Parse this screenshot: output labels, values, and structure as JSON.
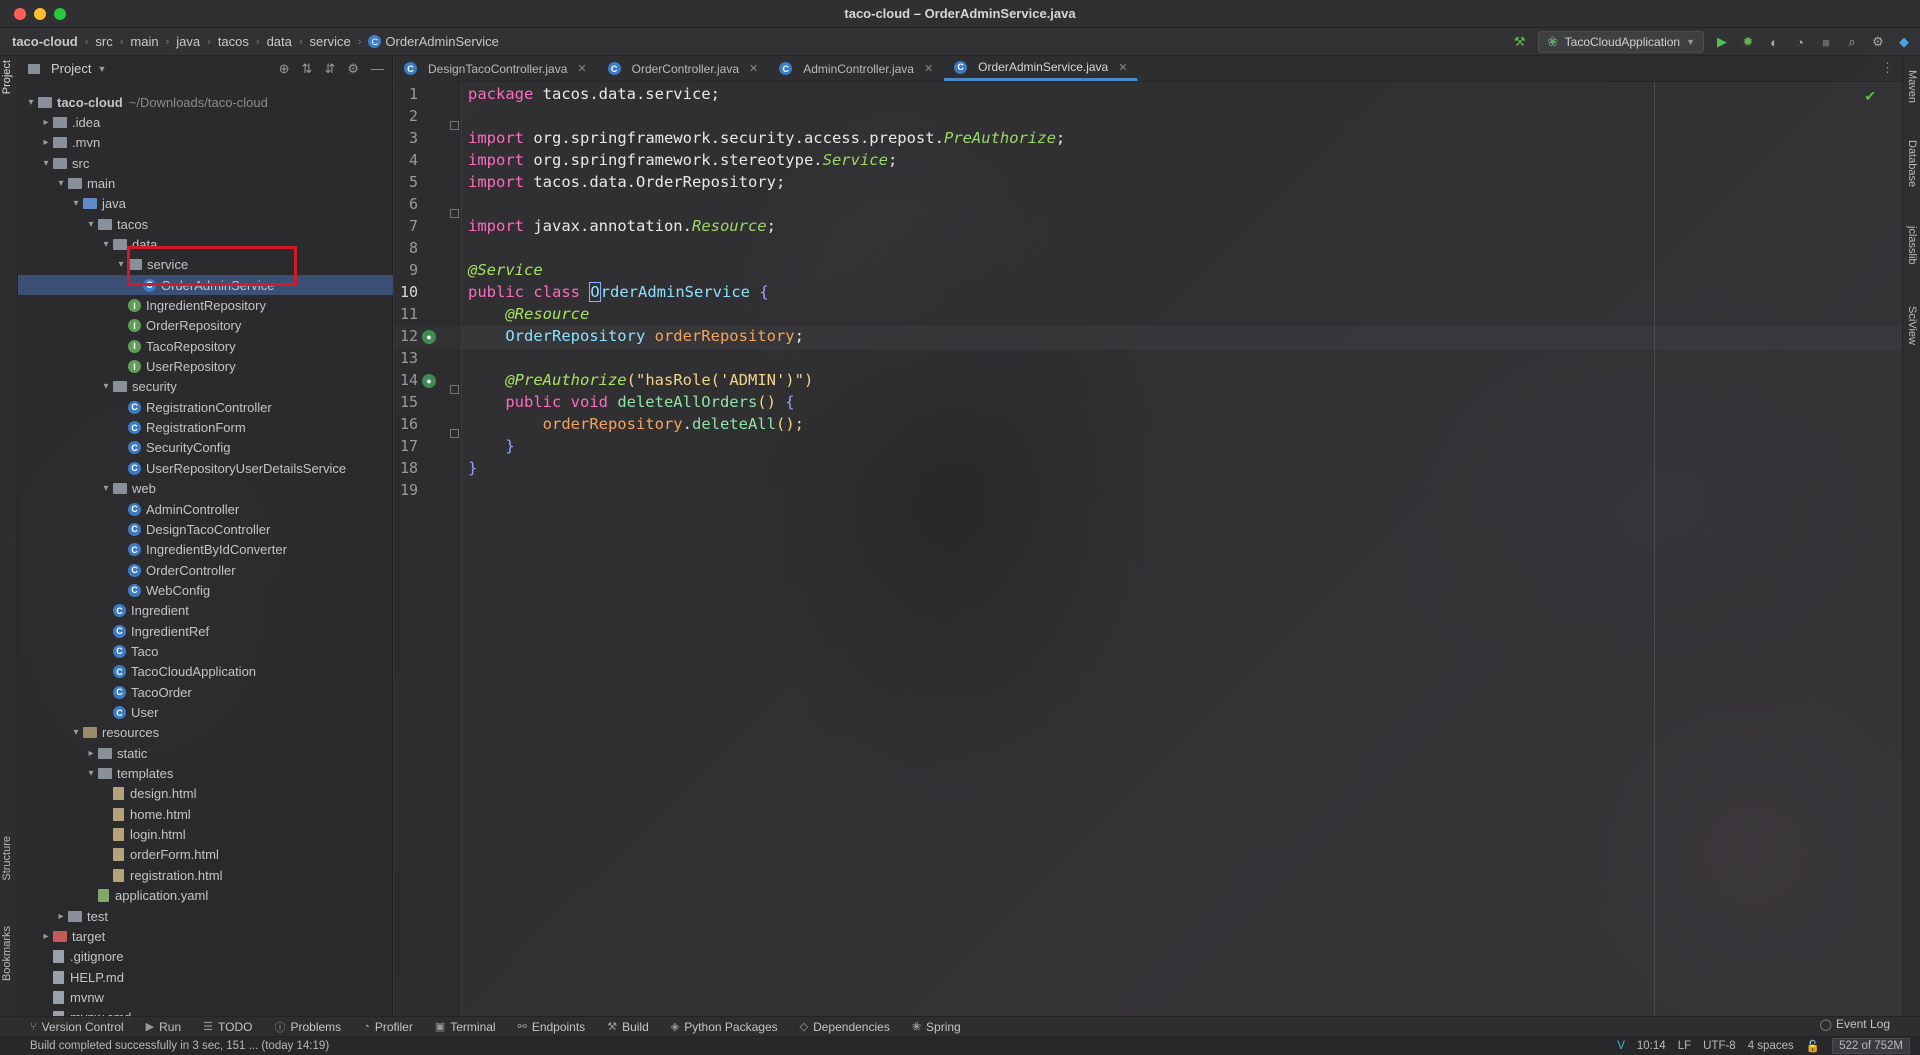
{
  "window": {
    "title": "taco-cloud – OrderAdminService.java"
  },
  "breadcrumbs": [
    "taco-cloud",
    "src",
    "main",
    "java",
    "tacos",
    "data",
    "service",
    "OrderAdminService"
  ],
  "run_config": {
    "label": "TacoCloudApplication"
  },
  "left_stripe": {
    "project_label": "Project",
    "structure_label": "Structure",
    "bookmarks_label": "Bookmarks"
  },
  "right_stripe": {
    "items": [
      "Maven",
      "Database",
      "jclasslib",
      "SciView"
    ]
  },
  "project_panel": {
    "header_label": "Project",
    "root_label": "taco-cloud",
    "root_path": "~/Downloads/taco-cloud",
    "tree": [
      {
        "label": "taco-cloud",
        "extra": "~/Downloads/taco-cloud",
        "icon": "folder",
        "depth": 0,
        "expanded": true
      },
      {
        "label": ".idea",
        "icon": "folder",
        "depth": 1,
        "expanded": false
      },
      {
        "label": ".mvn",
        "icon": "folder",
        "depth": 1,
        "expanded": false
      },
      {
        "label": "src",
        "icon": "folder",
        "depth": 1,
        "expanded": true
      },
      {
        "label": "main",
        "icon": "folder",
        "depth": 2,
        "expanded": true
      },
      {
        "label": "java",
        "icon": "folder-blue",
        "depth": 3,
        "expanded": true
      },
      {
        "label": "tacos",
        "icon": "folder",
        "depth": 4,
        "expanded": true
      },
      {
        "label": "data",
        "icon": "folder",
        "depth": 5,
        "expanded": true
      },
      {
        "label": "service",
        "icon": "folder",
        "depth": 6,
        "expanded": true
      },
      {
        "label": "OrderAdminService",
        "icon": "class",
        "depth": 7,
        "selected": true
      },
      {
        "label": "IngredientRepository",
        "icon": "interface",
        "depth": 6
      },
      {
        "label": "OrderRepository",
        "icon": "interface",
        "depth": 6
      },
      {
        "label": "TacoRepository",
        "icon": "interface",
        "depth": 6
      },
      {
        "label": "UserRepository",
        "icon": "interface",
        "depth": 6
      },
      {
        "label": "security",
        "icon": "folder",
        "depth": 5,
        "expanded": true
      },
      {
        "label": "RegistrationController",
        "icon": "class",
        "depth": 6
      },
      {
        "label": "RegistrationForm",
        "icon": "class",
        "depth": 6
      },
      {
        "label": "SecurityConfig",
        "icon": "class",
        "depth": 6
      },
      {
        "label": "UserRepositoryUserDetailsService",
        "icon": "class",
        "depth": 6
      },
      {
        "label": "web",
        "icon": "folder",
        "depth": 5,
        "expanded": true
      },
      {
        "label": "AdminController",
        "icon": "class",
        "depth": 6
      },
      {
        "label": "DesignTacoController",
        "icon": "class",
        "depth": 6
      },
      {
        "label": "IngredientByIdConverter",
        "icon": "class",
        "depth": 6
      },
      {
        "label": "OrderController",
        "icon": "class",
        "depth": 6
      },
      {
        "label": "WebConfig",
        "icon": "class",
        "depth": 6
      },
      {
        "label": "Ingredient",
        "icon": "class",
        "depth": 5
      },
      {
        "label": "IngredientRef",
        "icon": "class",
        "depth": 5
      },
      {
        "label": "Taco",
        "icon": "class",
        "depth": 5
      },
      {
        "label": "TacoCloudApplication",
        "icon": "class",
        "depth": 5
      },
      {
        "label": "TacoOrder",
        "icon": "class",
        "depth": 5
      },
      {
        "label": "User",
        "icon": "class",
        "depth": 5
      },
      {
        "label": "resources",
        "icon": "folder-res",
        "depth": 3,
        "expanded": true
      },
      {
        "label": "static",
        "icon": "folder",
        "depth": 4,
        "expanded": false
      },
      {
        "label": "templates",
        "icon": "folder",
        "depth": 4,
        "expanded": true
      },
      {
        "label": "design.html",
        "icon": "html",
        "depth": 5
      },
      {
        "label": "home.html",
        "icon": "html",
        "depth": 5
      },
      {
        "label": "login.html",
        "icon": "html",
        "depth": 5
      },
      {
        "label": "orderForm.html",
        "icon": "html",
        "depth": 5
      },
      {
        "label": "registration.html",
        "icon": "html",
        "depth": 5
      },
      {
        "label": "application.yaml",
        "icon": "yaml",
        "depth": 4
      },
      {
        "label": "test",
        "icon": "folder",
        "depth": 2,
        "expanded": false
      },
      {
        "label": "target",
        "icon": "folder-red",
        "depth": 1,
        "expanded": false
      },
      {
        "label": ".gitignore",
        "icon": "file",
        "depth": 1
      },
      {
        "label": "HELP.md",
        "icon": "file",
        "depth": 1
      },
      {
        "label": "mvnw",
        "icon": "file",
        "depth": 1
      },
      {
        "label": "mvnw.cmd",
        "icon": "file",
        "depth": 1
      }
    ]
  },
  "tabs": [
    {
      "label": "DesignTacoController.java",
      "active": false
    },
    {
      "label": "OrderController.java",
      "active": false
    },
    {
      "label": "AdminController.java",
      "active": false
    },
    {
      "label": "OrderAdminService.java",
      "active": true
    }
  ],
  "editor": {
    "current_line": 10,
    "lines": [
      {
        "n": "1"
      },
      {
        "n": "2"
      },
      {
        "n": "3"
      },
      {
        "n": "4"
      },
      {
        "n": "5"
      },
      {
        "n": "6"
      },
      {
        "n": "7"
      },
      {
        "n": "8"
      },
      {
        "n": "9"
      },
      {
        "n": "10"
      },
      {
        "n": "11"
      },
      {
        "n": "12"
      },
      {
        "n": "13"
      },
      {
        "n": "14"
      },
      {
        "n": "15"
      },
      {
        "n": "16"
      },
      {
        "n": "17"
      },
      {
        "n": "18"
      },
      {
        "n": "19"
      }
    ],
    "code": {
      "l1_kw": "package",
      "l1_rest": " tacos.data.service;",
      "l3_kw": "import",
      "l3_pkg": " org.springframework.security.access.prepost.",
      "l3_type": "PreAuthorize",
      "l3_end": ";",
      "l4_kw": "import",
      "l4_pkg": " org.springframework.stereotype.",
      "l4_type": "Service",
      "l4_end": ";",
      "l5_kw": "import",
      "l5_pkg": " tacos.data.OrderRepository;",
      "l7_kw": "import",
      "l7_pkg": " javax.annotation.",
      "l7_type": "Resource",
      "l7_end": ";",
      "l9_ann": "@Service",
      "l10_kw": "public class ",
      "l10_cursor": "O",
      "l10_cls": "rderAdminService",
      "l10_brace": " {",
      "l11_ann": "@Resource",
      "l12_type": "OrderRepository ",
      "l12_field": "orderRepository",
      "l12_end": ";",
      "l14_ann": "@PreAuthorize",
      "l14_paren": "(",
      "l14_str": "\"hasRole('ADMIN')\"",
      "l14_paren2": ")",
      "l15_kw": "public void ",
      "l15_fn": "deleteAllOrders",
      "l15_paren": "() ",
      "l15_brace": "{",
      "l16_field": "orderRepository",
      "l16_dot": ".",
      "l16_fn": "deleteAll",
      "l16_end": "();",
      "l17_brace": "}",
      "l18_brace": "}"
    }
  },
  "bottom_tools": [
    {
      "label": "Version Control",
      "icon": "branch-icon"
    },
    {
      "label": "Run",
      "icon": "play-icon"
    },
    {
      "label": "TODO",
      "icon": "list-icon"
    },
    {
      "label": "Problems",
      "icon": "warning-icon"
    },
    {
      "label": "Profiler",
      "icon": "profiler-icon"
    },
    {
      "label": "Terminal",
      "icon": "terminal-icon"
    },
    {
      "label": "Endpoints",
      "icon": "endpoints-icon"
    },
    {
      "label": "Build",
      "icon": "hammer-icon"
    },
    {
      "label": "Python Packages",
      "icon": "package-icon"
    },
    {
      "label": "Dependencies",
      "icon": "dependencies-icon"
    },
    {
      "label": "Spring",
      "icon": "spring-icon"
    }
  ],
  "event_log_label": "Event Log",
  "status": {
    "message": "Build completed successfully in 3 sec, 151 ... (today 14:19)",
    "position": "10:14",
    "line_sep": "LF",
    "encoding": "UTF-8",
    "indent": "4 spaces",
    "memory": "522 of 752M"
  },
  "colors": {
    "accent": "#4a88c7",
    "selection": "#4b6eaf",
    "highlight_box": "#d11a2a",
    "keyword": "#ff6ac1",
    "annotation": "#a7e35e"
  }
}
